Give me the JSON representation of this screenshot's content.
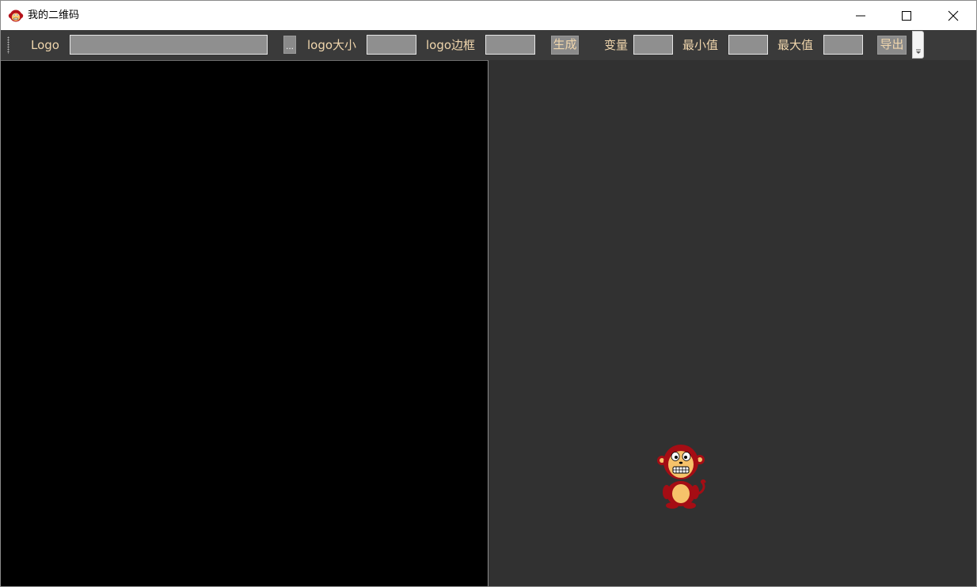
{
  "window": {
    "title": "我的二维码",
    "icon": "monkey-icon",
    "controls": {
      "minimize": "minimize-icon",
      "maximize": "maximize-icon",
      "close": "close-icon"
    }
  },
  "toolbar": {
    "logo_label": "Logo",
    "logo_path_value": "",
    "browse_button": "...",
    "logo_size_label": "logo大小",
    "logo_size_value": "",
    "logo_border_label": "logo边框",
    "logo_border_value": "",
    "generate_button": "生成",
    "variable_label": "变量",
    "variable_value": "",
    "min_label": "最小值",
    "min_value": "",
    "max_label": "最大值",
    "max_value": "",
    "export_button": "导出",
    "overflow_icon": "chevron-down-icon"
  },
  "colors": {
    "toolbar_bg": "#3a3a3a",
    "label_text": "#f0d6ad",
    "input_bg": "#8f8f8f",
    "left_pane_bg": "#000000",
    "right_pane_bg": "#313131"
  },
  "preview": {
    "mascot": "monkey-mascot"
  }
}
